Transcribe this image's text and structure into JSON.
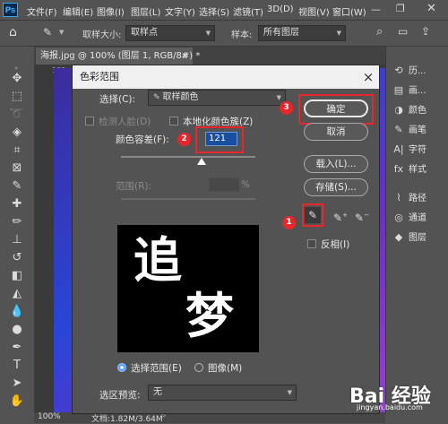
{
  "app": {
    "logo": "Ps"
  },
  "menubar": {
    "items": [
      "文件(F)",
      "编辑(E)",
      "图像(I)",
      "图层(L)",
      "文字(Y)",
      "选择(S)",
      "滤镜(T)",
      "3D(D)",
      "视图(V)",
      "窗口(W)"
    ]
  },
  "options_bar": {
    "sample_size_label": "取样大小:",
    "sample_size_value": "取样点",
    "sample_label": "样本:",
    "sample_value": "所有图层"
  },
  "document": {
    "tab_title": "海报.jpg @ 100% (图层 1, RGB/8#) *",
    "tab_close": "×",
    "ruler_mark": "100"
  },
  "status_bar": {
    "zoom": "100%",
    "doc_info": "文档:1.82M/3.64M"
  },
  "right_panel": {
    "items": [
      {
        "icon": "history-icon",
        "label": "历..."
      },
      {
        "icon": "canvas-icon",
        "label": "画..."
      },
      {
        "icon": "color-icon",
        "label": "颜色"
      },
      {
        "icon": "brush-icon",
        "label": "画笔"
      },
      {
        "icon": "character-icon",
        "label": "字符"
      },
      {
        "icon": "styles-icon",
        "label": "样式"
      },
      {
        "icon": "paths-icon",
        "label": "路径"
      },
      {
        "icon": "channels-icon",
        "label": "通道"
      },
      {
        "icon": "layers-icon",
        "label": "图层"
      }
    ],
    "character_glyph": "A|"
  },
  "dialog": {
    "title": "色彩范围",
    "close": "×",
    "select_label": "选择(C):",
    "select_value": "取样颜色",
    "detect_faces": "检测人脸(D)",
    "localized_clusters": "本地化颜色簇(Z)",
    "fuzziness_label": "颜色容差(F):",
    "fuzziness_value": "121",
    "range_label": "范围(R):",
    "range_unit": "%",
    "preview_text": [
      "追",
      "梦"
    ],
    "radio_selection": "选择范围(E)",
    "radio_image": "图像(M)",
    "selection_preview_label": "选区预览:",
    "selection_preview_value": "无",
    "buttons": {
      "ok": "确定",
      "cancel": "取消",
      "load": "载入(L)...",
      "save": "存储(S)..."
    },
    "invert_label": "反相(I)",
    "callouts": [
      "1",
      "2",
      "3"
    ]
  },
  "watermark": {
    "brand": "Bai 经验",
    "url": "jingyan.baidu.com"
  },
  "colors": {
    "accent": "#e8262b",
    "ps_blue": "#31a8ff",
    "canvas_blue": "#2945d8"
  }
}
